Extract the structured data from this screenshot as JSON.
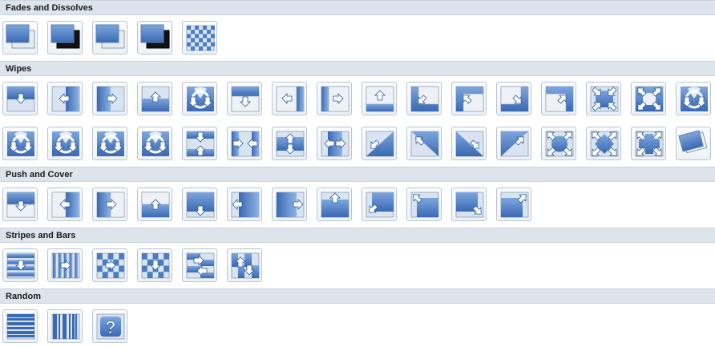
{
  "colors": {
    "header_bg": "#dde4ec",
    "tile_blue": "#4a7cc4",
    "tile_light": "#d9e4f2",
    "tile_border": "#b9c4d0"
  },
  "sections": [
    {
      "title": "Fades and Dissolves",
      "rows": [
        [
          "fade-smoothly",
          "fade-through-black",
          "cut",
          "cut-through-black",
          "dissolve"
        ]
      ]
    },
    {
      "title": "Wipes",
      "rows": [
        [
          "wipe-down",
          "wipe-left",
          "wipe-right",
          "wipe-up",
          "wedge",
          "uncover-down",
          "uncover-left",
          "uncover-right",
          "uncover-up",
          "uncover-left-down",
          "uncover-left-up",
          "uncover-right-down",
          "uncover-right-up",
          "box-in",
          "box-out",
          "wheel-1-spoke"
        ],
        [
          "wheel-2-spokes",
          "wheel-3-spokes",
          "wheel-4-spokes",
          "wheel-8-spokes",
          "split-horizontal-in",
          "split-vertical-in",
          "split-horizontal-out",
          "split-vertical-out",
          "strips-left-down",
          "strips-left-up",
          "strips-right-down",
          "strips-right-up",
          "circle",
          "diamond",
          "plus",
          "newsflash"
        ]
      ]
    },
    {
      "title": "Push and Cover",
      "rows": [
        [
          "push-down",
          "push-left",
          "push-right",
          "push-up",
          "cover-down",
          "cover-left",
          "cover-right",
          "cover-up",
          "cover-left-down",
          "cover-left-up",
          "cover-right-down",
          "cover-right-up"
        ]
      ]
    },
    {
      "title": "Stripes and Bars",
      "rows": [
        [
          "blinds-horizontal",
          "blinds-vertical",
          "checkerboard-across",
          "checkerboard-down",
          "comb-horizontal",
          "comb-vertical"
        ]
      ]
    },
    {
      "title": "Random",
      "rows": [
        [
          "random-bars-horizontal",
          "random-bars-vertical",
          "random-transition"
        ]
      ]
    }
  ]
}
